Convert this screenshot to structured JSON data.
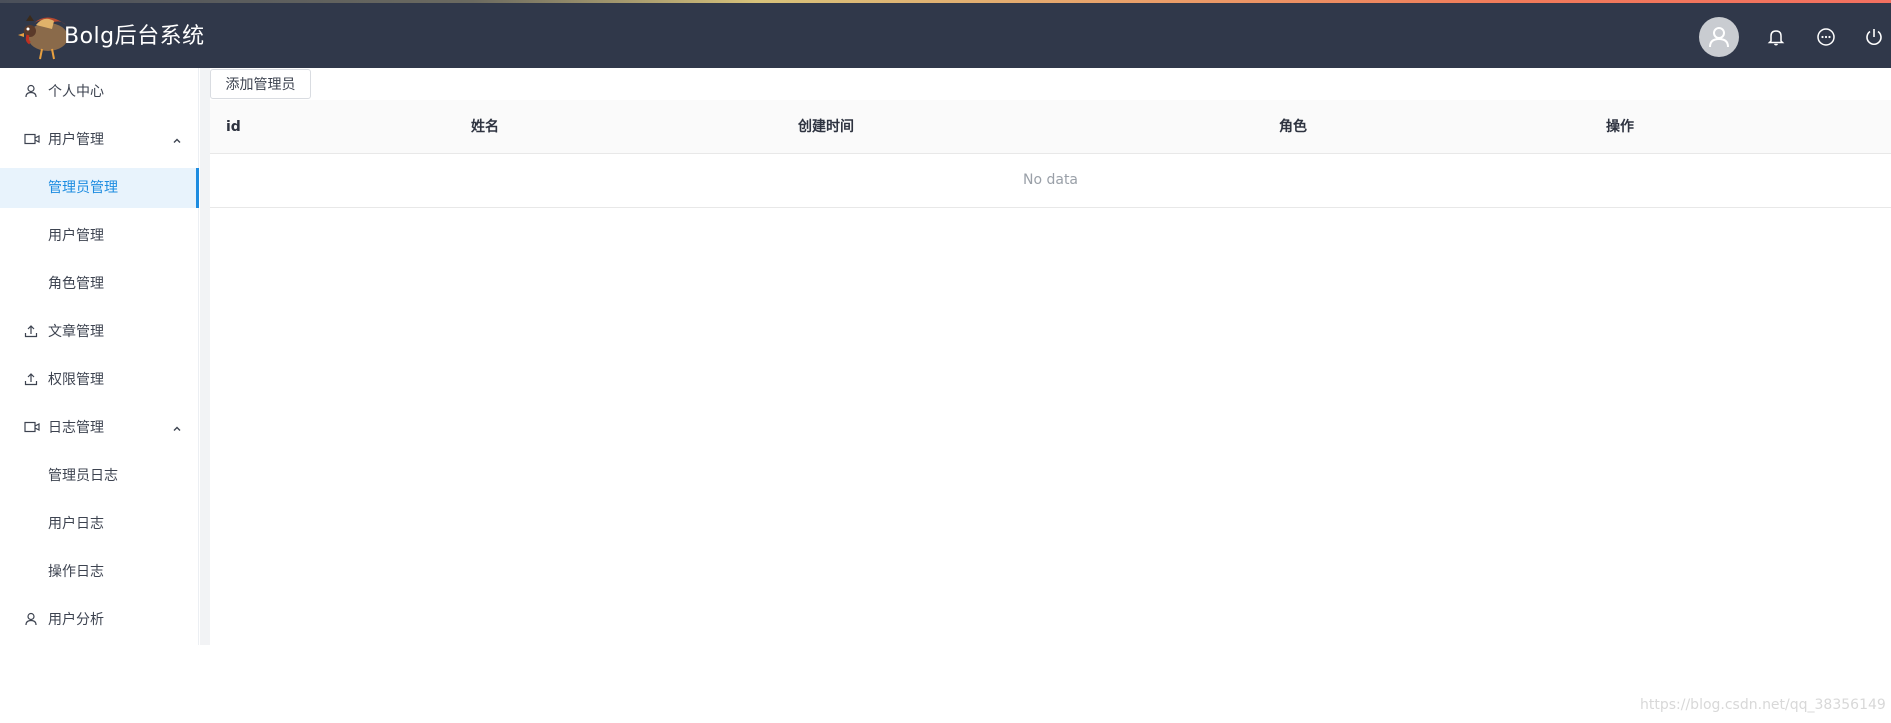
{
  "header": {
    "brand": "Bolg后台系统",
    "icons": [
      "avatar-icon",
      "bell-icon",
      "message-icon",
      "power-icon"
    ]
  },
  "sidebar": {
    "items": [
      {
        "label": "个人中心",
        "icon": "user-icon"
      },
      {
        "label": "用户管理",
        "icon": "video-icon",
        "expanded": true
      },
      {
        "label": "管理员管理",
        "active": true
      },
      {
        "label": "用户管理"
      },
      {
        "label": "角色管理"
      },
      {
        "label": "文章管理",
        "icon": "upload-icon"
      },
      {
        "label": "权限管理",
        "icon": "upload-icon"
      },
      {
        "label": "日志管理",
        "icon": "video-icon",
        "expanded": true
      },
      {
        "label": "管理员日志"
      },
      {
        "label": "用户日志"
      },
      {
        "label": "操作日志"
      },
      {
        "label": "用户分析",
        "icon": "user-icon"
      }
    ]
  },
  "main": {
    "add_button": "添加管理员",
    "table": {
      "columns": [
        "id",
        "姓名",
        "创建时间",
        "角色",
        "操作"
      ],
      "empty_text": "No data"
    }
  },
  "watermark": "https://blog.csdn.net/qq_38356149",
  "colors": {
    "header_bg": "#30384a",
    "accent": "#1d8ce0",
    "active_bg": "#e8f3fc"
  }
}
